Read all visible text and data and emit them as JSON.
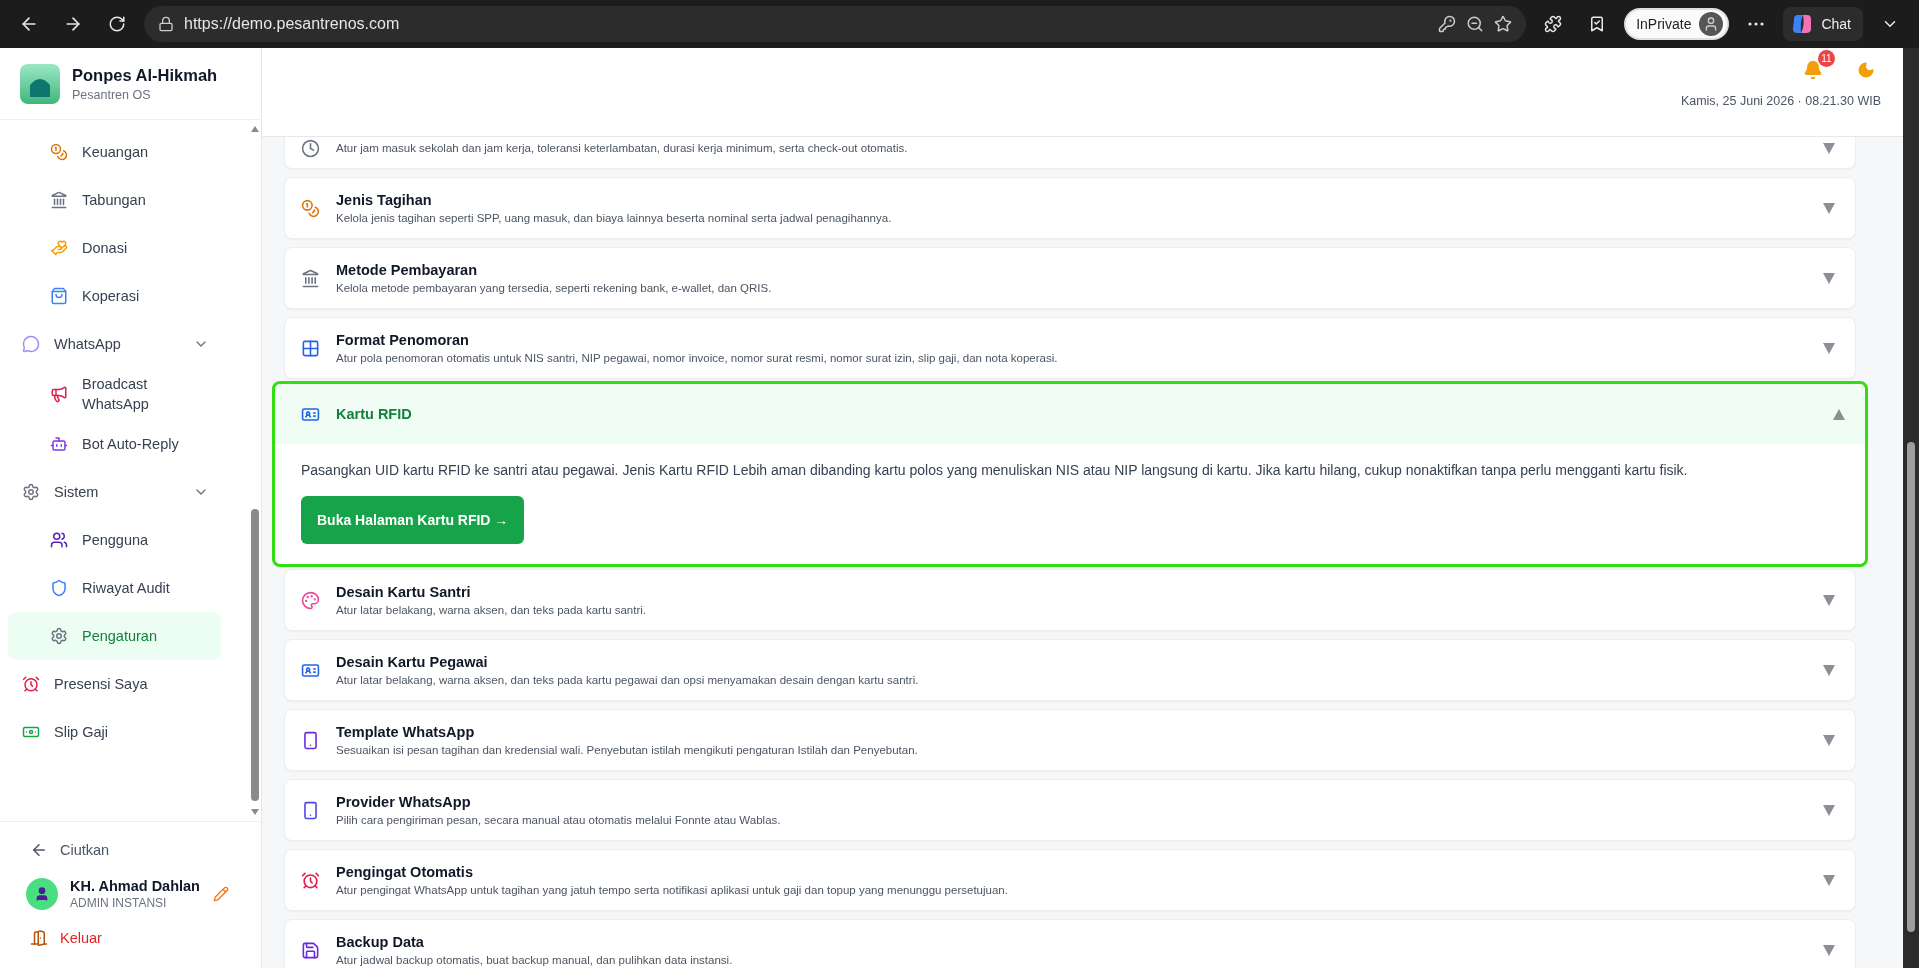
{
  "browser": {
    "url": "https://demo.pesantrenos.com",
    "profile_label": "InPrivate",
    "chat_label": "Chat"
  },
  "sidebar": {
    "brand": {
      "name": "Ponpes Al-Hikmah",
      "subtitle": "Pesantren OS"
    },
    "nav": [
      {
        "children": [
          {
            "label": "Keuangan",
            "selected": false
          },
          {
            "label": "Tabungan",
            "selected": false
          },
          {
            "label": "Donasi",
            "selected": false
          },
          {
            "label": "Koperasi",
            "selected": false
          }
        ]
      },
      {
        "label": "WhatsApp",
        "selected": false,
        "expanded": true,
        "children": [
          {
            "label": "Broadcast WhatsApp",
            "selected": false
          },
          {
            "label": "Bot Auto-Reply",
            "selected": false
          }
        ]
      },
      {
        "label": "Sistem",
        "selected": false,
        "expanded": true,
        "children": [
          {
            "label": "Pengguna",
            "selected": false
          },
          {
            "label": "Riwayat Audit",
            "selected": false
          },
          {
            "label": "Pengaturan",
            "selected": true
          }
        ]
      },
      {
        "label": "Presensi Saya",
        "selected": false
      },
      {
        "label": "Slip Gaji",
        "selected": false
      }
    ],
    "collapse_label": "Ciutkan",
    "user": {
      "name": "KH. Ahmad Dahlan",
      "role": "ADMIN INSTANSI"
    },
    "logout_label": "Keluar"
  },
  "header": {
    "notification_count": "11",
    "datetime": "Kamis, 25 Juni 2026 · 08.21.30 WIB"
  },
  "settings": [
    {
      "description": "Atur jam masuk sekolah dan jam kerja, toleransi keterlambatan, durasi kerja minimum, serta check-out otomatis.",
      "expanded": false
    },
    {
      "title": "Jenis Tagihan",
      "description": "Kelola jenis tagihan seperti SPP, uang masuk, dan biaya lainnya beserta nominal serta jadwal penagihannya.",
      "expanded": false
    },
    {
      "title": "Metode Pembayaran",
      "description": "Kelola metode pembayaran yang tersedia, seperti rekening bank, e-wallet, dan QRIS.",
      "expanded": false
    },
    {
      "title": "Format Penomoran",
      "description": "Atur pola penomoran otomatis untuk NIS santri, NIP pegawai, nomor invoice, nomor surat resmi, nomor surat izin, slip gaji, dan nota koperasi.",
      "expanded": false
    },
    {
      "title": "Kartu RFID",
      "expanded": true,
      "body": "Pasangkan UID kartu RFID ke santri atau pegawai. Jenis Kartu RFID Lebih aman dibanding kartu polos yang menuliskan NIS atau NIP langsung di kartu. Jika kartu hilang, cukup nonaktifkan tanpa perlu mengganti kartu fisik.",
      "button": "Buka Halaman Kartu RFID →"
    },
    {
      "title": "Desain Kartu Santri",
      "description": "Atur latar belakang, warna aksen, dan teks pada kartu santri.",
      "expanded": false
    },
    {
      "title": "Desain Kartu Pegawai",
      "description": "Atur latar belakang, warna aksen, dan teks pada kartu pegawai dan opsi menyamakan desain dengan kartu santri.",
      "expanded": false
    },
    {
      "title": "Template WhatsApp",
      "description": "Sesuaikan isi pesan tagihan dan kredensial wali. Penyebutan istilah mengikuti pengaturan Istilah dan Penyebutan.",
      "expanded": false
    },
    {
      "title": "Provider WhatsApp",
      "description": "Pilih cara pengiriman pesan, secara manual atau otomatis melalui Fonnte atau Wablas.",
      "expanded": false
    },
    {
      "title": "Pengingat Otomatis",
      "description": "Atur pengingat WhatsApp untuk tagihan yang jatuh tempo serta notifikasi aplikasi untuk gaji dan topup yang menunggu persetujuan.",
      "expanded": false
    },
    {
      "title": "Backup Data",
      "description": "Atur jadwal backup otomatis, buat backup manual, dan pulihkan data instansi.",
      "expanded": false
    }
  ]
}
